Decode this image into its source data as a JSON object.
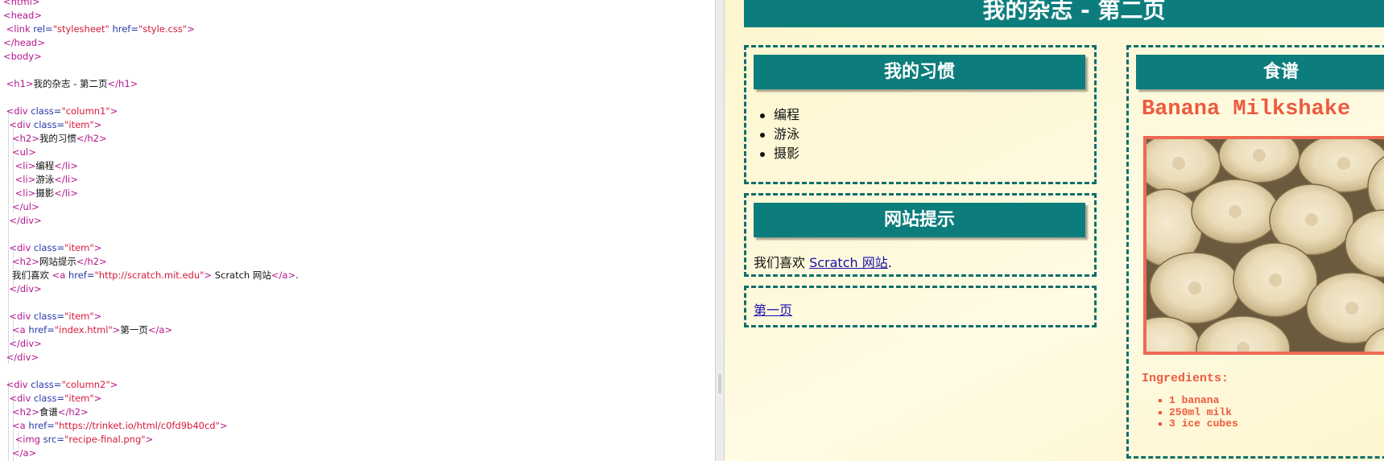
{
  "editor": {
    "lines": [
      [
        [
          "tag",
          "<html>"
        ]
      ],
      [
        [
          "tag",
          "<head>"
        ]
      ],
      [
        [
          "text",
          " "
        ],
        [
          "tag",
          "<link "
        ],
        [
          "attr",
          "rel="
        ],
        [
          "str",
          "\"stylesheet\""
        ],
        [
          "attr",
          " href="
        ],
        [
          "str",
          "\"style.css\""
        ],
        [
          "tag",
          ">"
        ]
      ],
      [
        [
          "tag",
          "</head>"
        ]
      ],
      [
        [
          "tag",
          "<body>"
        ]
      ],
      [],
      [
        [
          "text",
          " "
        ],
        [
          "tag",
          "<h1>"
        ],
        [
          "text",
          "我的杂志 - 第二页"
        ],
        [
          "tag",
          "</h1>"
        ]
      ],
      [],
      [
        [
          "text",
          " "
        ],
        [
          "tag",
          "<div "
        ],
        [
          "attr",
          "class="
        ],
        [
          "str",
          "\"column1\""
        ],
        [
          "tag",
          ">"
        ]
      ],
      [
        [
          "text",
          "  "
        ],
        [
          "tag",
          "<div "
        ],
        [
          "attr",
          "class="
        ],
        [
          "str",
          "\"item\""
        ],
        [
          "tag",
          ">"
        ]
      ],
      [
        [
          "text",
          "   "
        ],
        [
          "tag",
          "<h2>"
        ],
        [
          "text",
          "我的习惯"
        ],
        [
          "tag",
          "</h2>"
        ]
      ],
      [
        [
          "text",
          "   "
        ],
        [
          "tag",
          "<ul>"
        ]
      ],
      [
        [
          "text",
          "    "
        ],
        [
          "tag",
          "<li>"
        ],
        [
          "text",
          "编程"
        ],
        [
          "tag",
          "</li>"
        ]
      ],
      [
        [
          "text",
          "    "
        ],
        [
          "tag",
          "<li>"
        ],
        [
          "text",
          "游泳"
        ],
        [
          "tag",
          "</li>"
        ]
      ],
      [
        [
          "text",
          "    "
        ],
        [
          "tag",
          "<li>"
        ],
        [
          "text",
          "摄影"
        ],
        [
          "tag",
          "</li>"
        ]
      ],
      [
        [
          "text",
          "   "
        ],
        [
          "tag",
          "</ul>"
        ]
      ],
      [
        [
          "text",
          "  "
        ],
        [
          "tag",
          "</div>"
        ]
      ],
      [],
      [
        [
          "text",
          "  "
        ],
        [
          "tag",
          "<div "
        ],
        [
          "attr",
          "class="
        ],
        [
          "str",
          "\"item\""
        ],
        [
          "tag",
          ">"
        ]
      ],
      [
        [
          "text",
          "   "
        ],
        [
          "tag",
          "<h2>"
        ],
        [
          "text",
          "网站提示"
        ],
        [
          "tag",
          "</h2>"
        ]
      ],
      [
        [
          "text",
          "   我们喜欢 "
        ],
        [
          "tag",
          "<a "
        ],
        [
          "attr",
          "href="
        ],
        [
          "str",
          "\"http://scratch.mit.edu\""
        ],
        [
          "tag",
          ">"
        ],
        [
          "text",
          " Scratch 网站"
        ],
        [
          "tag",
          "</a>"
        ],
        [
          "text",
          "."
        ]
      ],
      [
        [
          "text",
          "  "
        ],
        [
          "tag",
          "</div>"
        ]
      ],
      [],
      [
        [
          "text",
          "  "
        ],
        [
          "tag",
          "<div "
        ],
        [
          "attr",
          "class="
        ],
        [
          "str",
          "\"item\""
        ],
        [
          "tag",
          ">"
        ]
      ],
      [
        [
          "text",
          "   "
        ],
        [
          "tag",
          "<a "
        ],
        [
          "attr",
          "href="
        ],
        [
          "str",
          "\"index.html\""
        ],
        [
          "tag",
          ">"
        ],
        [
          "text",
          "第一页"
        ],
        [
          "tag",
          "</a>"
        ]
      ],
      [
        [
          "text",
          "  "
        ],
        [
          "tag",
          "</div>"
        ]
      ],
      [
        [
          "text",
          " "
        ],
        [
          "tag",
          "</div>"
        ]
      ],
      [],
      [
        [
          "text",
          " "
        ],
        [
          "tag",
          "<div "
        ],
        [
          "attr",
          "class="
        ],
        [
          "str",
          "\"column2\""
        ],
        [
          "tag",
          ">"
        ]
      ],
      [
        [
          "text",
          "  "
        ],
        [
          "tag",
          "<div "
        ],
        [
          "attr",
          "class="
        ],
        [
          "str",
          "\"item\""
        ],
        [
          "tag",
          ">"
        ]
      ],
      [
        [
          "text",
          "   "
        ],
        [
          "tag",
          "<h2>"
        ],
        [
          "text",
          "食谱"
        ],
        [
          "tag",
          "</h2>"
        ]
      ],
      [
        [
          "text",
          "   "
        ],
        [
          "tag",
          "<a "
        ],
        [
          "attr",
          "href="
        ],
        [
          "str",
          "\"https://trinket.io/html/c0fd9b40cd\""
        ],
        [
          "tag",
          ">"
        ]
      ],
      [
        [
          "text",
          "    "
        ],
        [
          "tag",
          "<img "
        ],
        [
          "attr",
          "src="
        ],
        [
          "str",
          "\"recipe-final.png\""
        ],
        [
          "tag",
          ">"
        ]
      ],
      [
        [
          "text",
          "   "
        ],
        [
          "tag",
          "</a>"
        ]
      ]
    ]
  },
  "preview": {
    "page_title": "我的杂志 - 第二页",
    "habits": {
      "heading": "我的习惯",
      "items": [
        "编程",
        "游泳",
        "摄影"
      ]
    },
    "tips": {
      "text_before": "我们喜欢 ",
      "link_text": "Scratch 网站",
      "text_after": "."
    },
    "nav": {
      "link_text": "第一页"
    },
    "recipe": {
      "heading": "食谱",
      "title": "Banana Milkshake",
      "ingredients_title": "Ingredients:",
      "ingredients": [
        "1 banana",
        "250ml milk",
        "3 ice cubes"
      ]
    }
  },
  "colors": {
    "accent": "#0c7d7c",
    "recipe": "#ee5a3f",
    "tag": "#b4138c",
    "attr": "#2838a8",
    "string": "#d5193a"
  }
}
